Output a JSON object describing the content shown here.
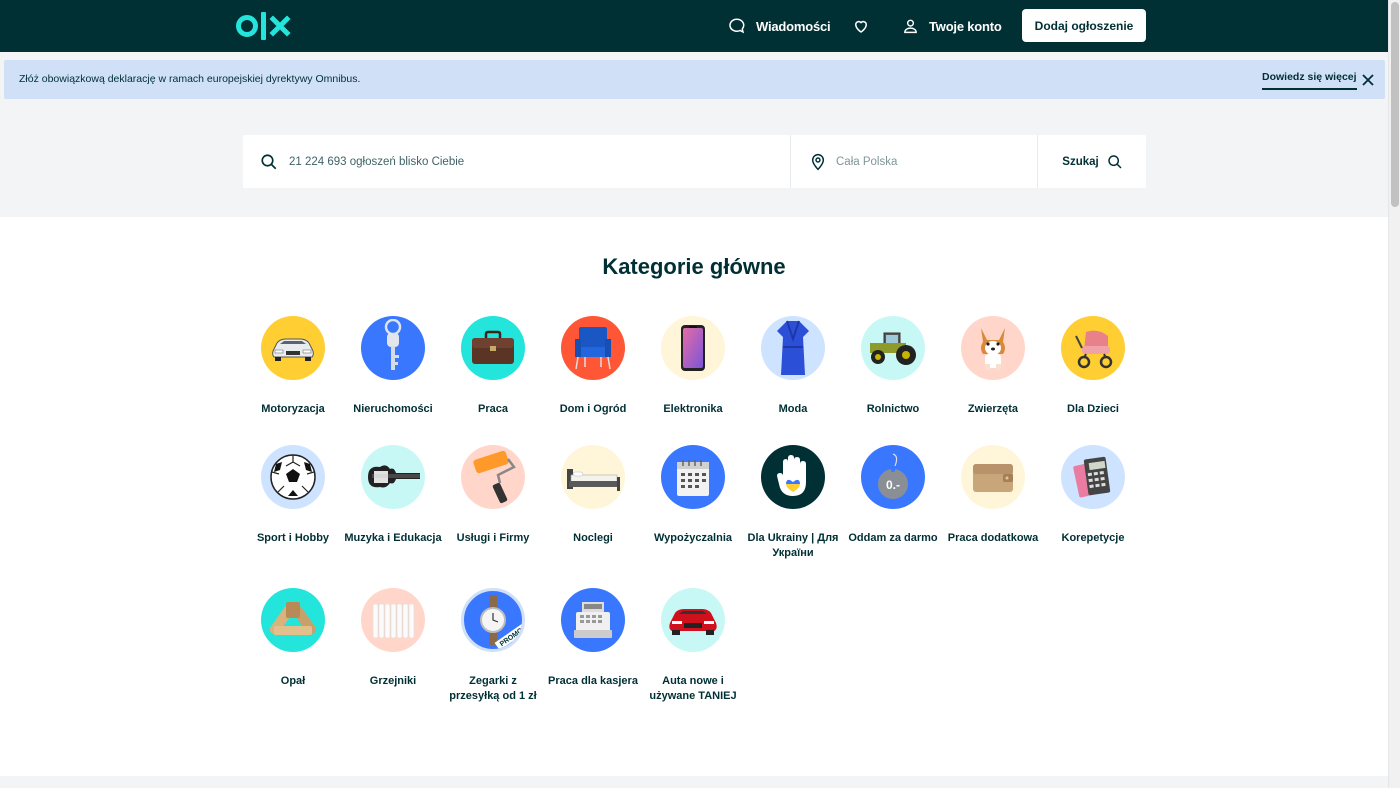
{
  "header": {
    "logo": "olx",
    "messages_label": "Wiadomości",
    "account_label": "Twoje konto",
    "add_listing_label": "Dodaj ogłoszenie"
  },
  "banner": {
    "text": "Złóż obowiązkową deklarację w ramach europejskiej dyrektywy Omnibus.",
    "link_label": "Dowiedz się więcej"
  },
  "search": {
    "query_placeholder": "21 224 693 ogłoszeń blisko Ciebie",
    "location_placeholder": "Cała Polska",
    "button_label": "Szukaj"
  },
  "categories": {
    "title": "Kategorie główne",
    "items": [
      {
        "label": "Motoryzacja",
        "color": "#ffce32"
      },
      {
        "label": "Nieruchomości",
        "color": "#3a77ff"
      },
      {
        "label": "Praca",
        "color": "#23e5db"
      },
      {
        "label": "Dom i Ogród",
        "color": "#ff5636"
      },
      {
        "label": "Elektronika",
        "color": "#fff6d9"
      },
      {
        "label": "Moda",
        "color": "#cee3ff"
      },
      {
        "label": "Rolnictwo",
        "color": "#c8f8f6"
      },
      {
        "label": "Zwierzęta",
        "color": "#ffd6c9"
      },
      {
        "label": "Dla Dzieci",
        "color": "#ffce32"
      },
      {
        "label": "Sport i Hobby",
        "color": "#cee3ff"
      },
      {
        "label": "Muzyka i Edukacja",
        "color": "#c8f8f6"
      },
      {
        "label": "Usługi i Firmy",
        "color": "#ffd6c9"
      },
      {
        "label": "Noclegi",
        "color": "#fff6d9"
      },
      {
        "label": "Wypożyczalnia",
        "color": "#3a77ff"
      },
      {
        "label": "Dla Ukrainy | Для України",
        "color": "#002f34"
      },
      {
        "label": "Oddam za darmo",
        "color": "#3a77ff"
      },
      {
        "label": "Praca dodatkowa",
        "color": "#fff6d9"
      },
      {
        "label": "Korepetycje",
        "color": "#cee3ff"
      },
      {
        "label": "Opał",
        "color": "#23e5db"
      },
      {
        "label": "Grzejniki",
        "color": "#ffd6c9"
      },
      {
        "label": "Zegarki z przesyłką od 1 zł",
        "color": "#3a77ff"
      },
      {
        "label": "Praca dla kasjera",
        "color": "#3a77ff"
      },
      {
        "label": "Auta nowe i używane TANIEJ",
        "color": "#c8f8f6"
      }
    ],
    "free_badge": "0.-",
    "promo_badge": "PROMO"
  }
}
